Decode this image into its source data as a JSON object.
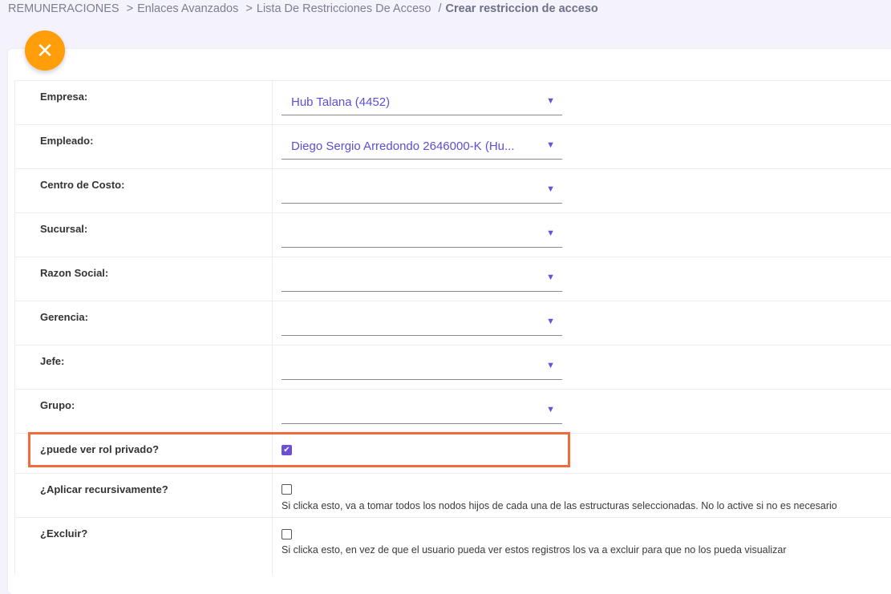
{
  "breadcrumb": {
    "items": [
      "REMUNERACIONES",
      "Enlaces Avanzados",
      "Lista De Restricciones De Acceso"
    ],
    "separators": [
      ">",
      ">",
      "/"
    ],
    "current": "Crear restriccion de acceso"
  },
  "close_button": {
    "icon": "close-icon",
    "glyph": "✕",
    "color": "#ff9d0a"
  },
  "fields": [
    {
      "label": "Empresa:",
      "value": "Hub Talana (4452)"
    },
    {
      "label": "Empleado:",
      "value": "Diego Sergio Arredondo 2646000-K (Hu..."
    },
    {
      "label": "Centro de Costo:",
      "value": ""
    },
    {
      "label": "Sucursal:",
      "value": ""
    },
    {
      "label": "Razon Social:",
      "value": ""
    },
    {
      "label": "Gerencia:",
      "value": ""
    },
    {
      "label": "Jefe:",
      "value": ""
    },
    {
      "label": "Grupo:",
      "value": ""
    }
  ],
  "checkboxes": {
    "rol_privado": {
      "label": "¿puede ver rol privado?",
      "checked": true
    },
    "recursivo": {
      "label": "¿Aplicar recursivamente?",
      "checked": false,
      "help": "Si clicka esto, va a tomar todos los nodos hijos de cada una de las estructuras seleccionadas. No lo active si no es necesario"
    },
    "excluir": {
      "label": "¿Excluir?",
      "checked": false,
      "help": "Si clicka esto, en vez de que el usuario pueda ver estos registros los va a excluir para que no los pueda visualizar"
    }
  },
  "colors": {
    "accent": "#6c4fd6",
    "highlight": "#f46b3a"
  }
}
